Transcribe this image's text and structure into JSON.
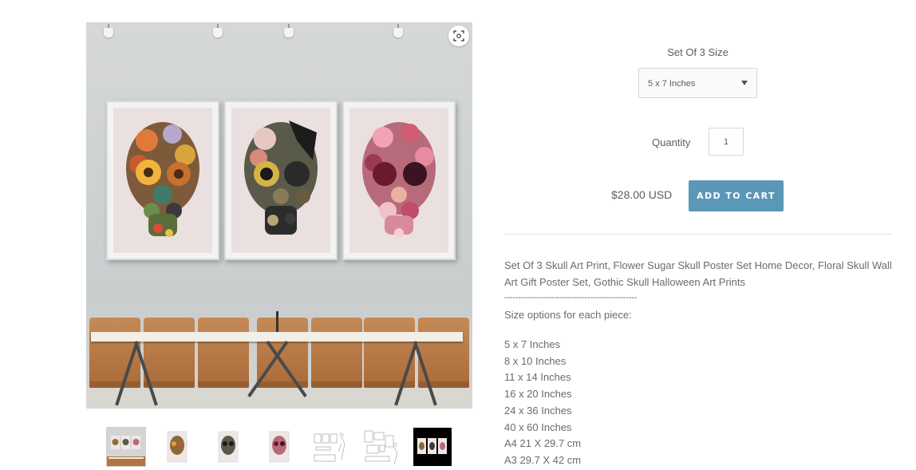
{
  "product": {
    "size_label": "Set Of 3 Size",
    "size_selected": "5 x 7 Inches",
    "quantity_label": "Quantity",
    "quantity_value": "1",
    "price": "$28.00 USD",
    "add_to_cart_label": "ADD TO CART",
    "accent_color": "#5b97b6"
  },
  "gallery": {
    "zoom_icon": "zoom-icon",
    "thumbnail_count": 7,
    "selected_thumbnail": 1
  },
  "description": {
    "title": "Set Of 3 Skull Art Print, Flower Sugar Skull Poster Set Home Decor, Floral Skull Wall Art Gift Poster Set, Gothic Skull Halloween Art Prints",
    "separator": "------------------------------------------------",
    "size_heading": "Size options for each piece:",
    "sizes": [
      "5 x 7 Inches",
      "8 x 10 Inches",
      "11 x 14 Inches",
      "16 x 20 Inches",
      "24 x 36 Inches",
      "40 x 60 Inches",
      "A4 21 X 29.7 cm",
      "A3 29.7 X 42 cm"
    ]
  }
}
